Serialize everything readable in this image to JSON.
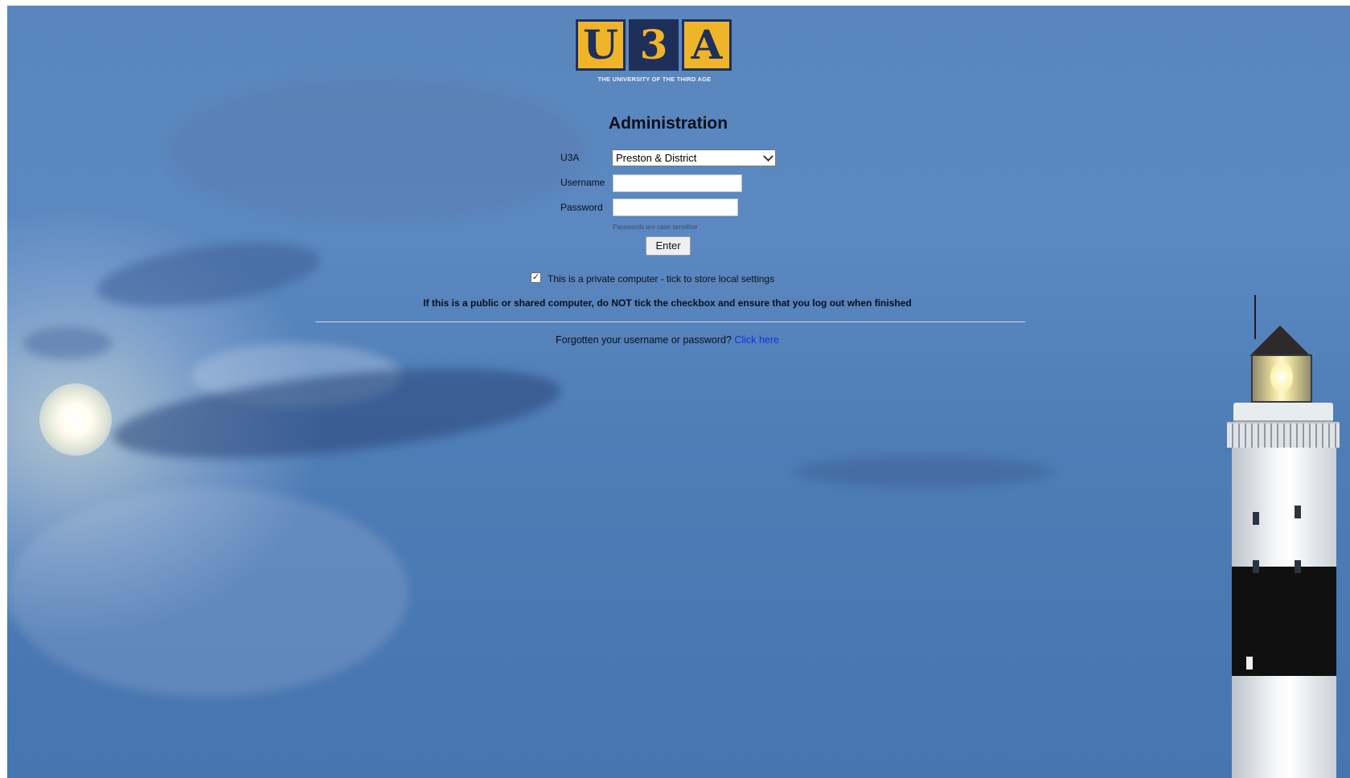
{
  "logo": {
    "letters": [
      "U",
      "3",
      "A"
    ],
    "tagline": "THE UNIVERSITY OF THE THIRD AGE",
    "colors": {
      "gold": "#f0b429",
      "navy": "#1e2f5a"
    }
  },
  "page": {
    "title": "Administration"
  },
  "form": {
    "u3a_label": "U3A",
    "u3a_selected": "Preston & District",
    "username_label": "Username",
    "username_value": "",
    "password_label": "Password",
    "password_value": "",
    "password_hint": "Passwords are case sensitive",
    "enter_label": "Enter"
  },
  "private_computer": {
    "checked": true,
    "label": "This is a private computer - tick to store local settings"
  },
  "warning": "If this is a public or shared computer, do NOT tick the checkbox and ensure that you log out when finished",
  "forgot": {
    "text": "Forgotten your username or password?",
    "link_label": "Click here"
  },
  "background": {
    "sky_color": "#5583bb",
    "link_color": "#1330e8"
  }
}
